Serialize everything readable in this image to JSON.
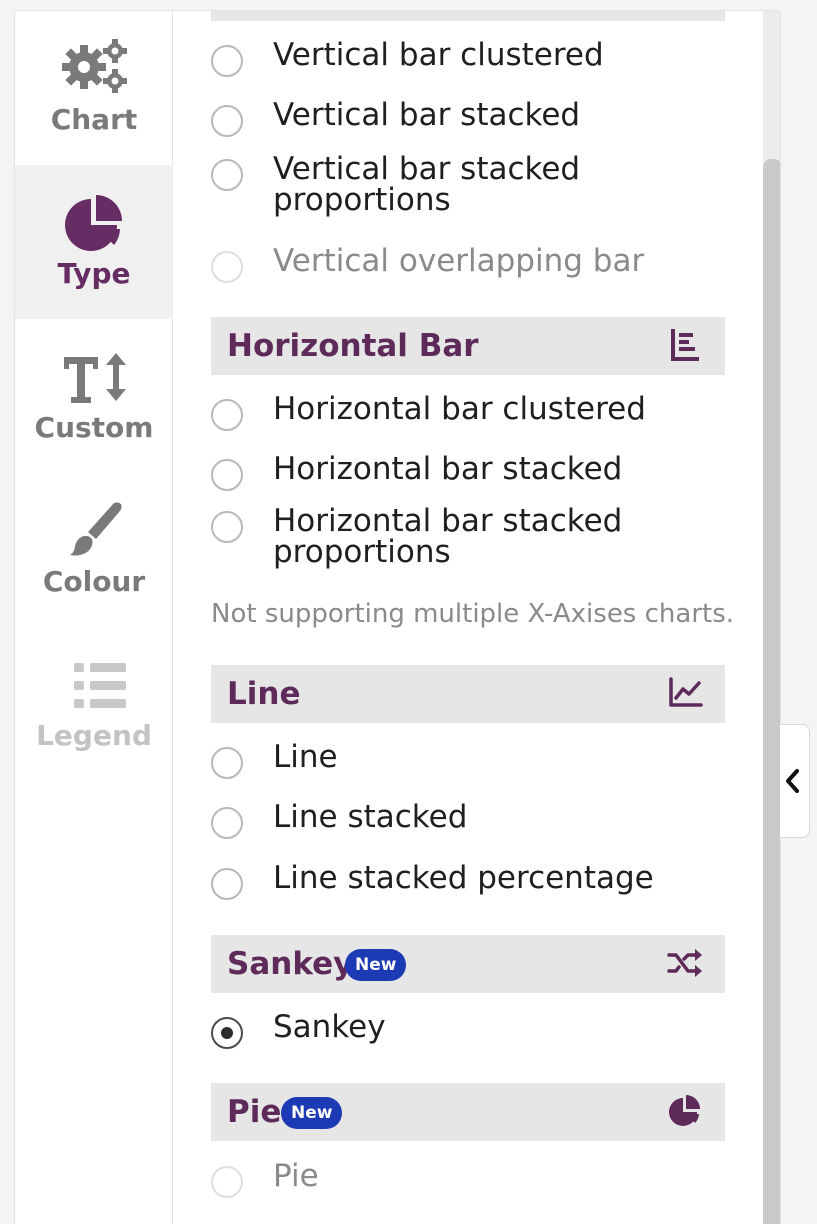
{
  "rail": {
    "items": [
      {
        "label": "Chart",
        "icon": "gears-icon"
      },
      {
        "label": "Type",
        "icon": "pie-chart-icon"
      },
      {
        "label": "Custom",
        "icon": "text-size-icon"
      },
      {
        "label": "Colour",
        "icon": "paintbrush-icon"
      },
      {
        "label": "Legend",
        "icon": "list-icon"
      }
    ],
    "active": "Type"
  },
  "options_vertical": [
    {
      "label": "Vertical bar clustered",
      "checked": false,
      "disabled": false
    },
    {
      "label": "Vertical bar stacked",
      "checked": false,
      "disabled": false
    },
    {
      "label": "Vertical bar stacked proportions",
      "checked": false,
      "disabled": false
    },
    {
      "label": "Vertical overlapping bar",
      "checked": false,
      "disabled": true
    }
  ],
  "sections": {
    "horizontal_bar": {
      "title": "Horizontal Bar",
      "icon": "horizontal-bar-chart-icon"
    },
    "line": {
      "title": "Line",
      "icon": "line-chart-icon"
    },
    "sankey": {
      "title": "Sankey",
      "badge": "New",
      "icon": "shuffle-icon"
    },
    "pie": {
      "title": "Pie",
      "badge": "New",
      "icon": "pie-chart-icon"
    }
  },
  "options_horizontal": [
    {
      "label": "Horizontal bar clustered",
      "checked": false
    },
    {
      "label": "Horizontal bar stacked",
      "checked": false
    },
    {
      "label": "Horizontal bar stacked proportions",
      "checked": false
    }
  ],
  "horizontal_note": "Not supporting multiple X-Axises charts.",
  "options_line": [
    {
      "label": "Line",
      "checked": false
    },
    {
      "label": "Line stacked",
      "checked": false
    },
    {
      "label": "Line stacked percentage",
      "checked": false
    }
  ],
  "options_sankey": [
    {
      "label": "Sankey",
      "checked": true
    }
  ],
  "options_pie": [
    {
      "label": "Pie",
      "checked": false,
      "disabled": true
    }
  ],
  "colors": {
    "accent": "#5d2a5a",
    "badge": "#1c3ab4",
    "section_bg": "#e6e6e6"
  }
}
